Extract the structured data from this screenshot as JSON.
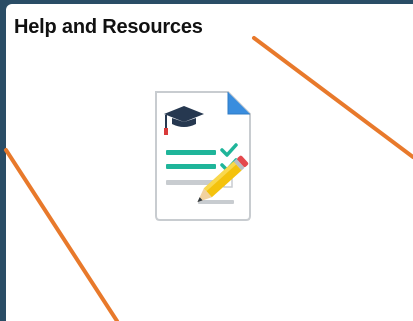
{
  "tile": {
    "title": "Help and Resources",
    "icon": "document-checklist-graduation-cap-pencil-icon"
  },
  "colors": {
    "page_background": "#2a4d66",
    "tile_background": "#ffffff",
    "title_text": "#111111",
    "annotation_line": "#e8792b",
    "document_corner": "#3a8dde",
    "check_marks": "#1fb59a",
    "cap": "#263850",
    "pencil": "#f4c20d"
  }
}
